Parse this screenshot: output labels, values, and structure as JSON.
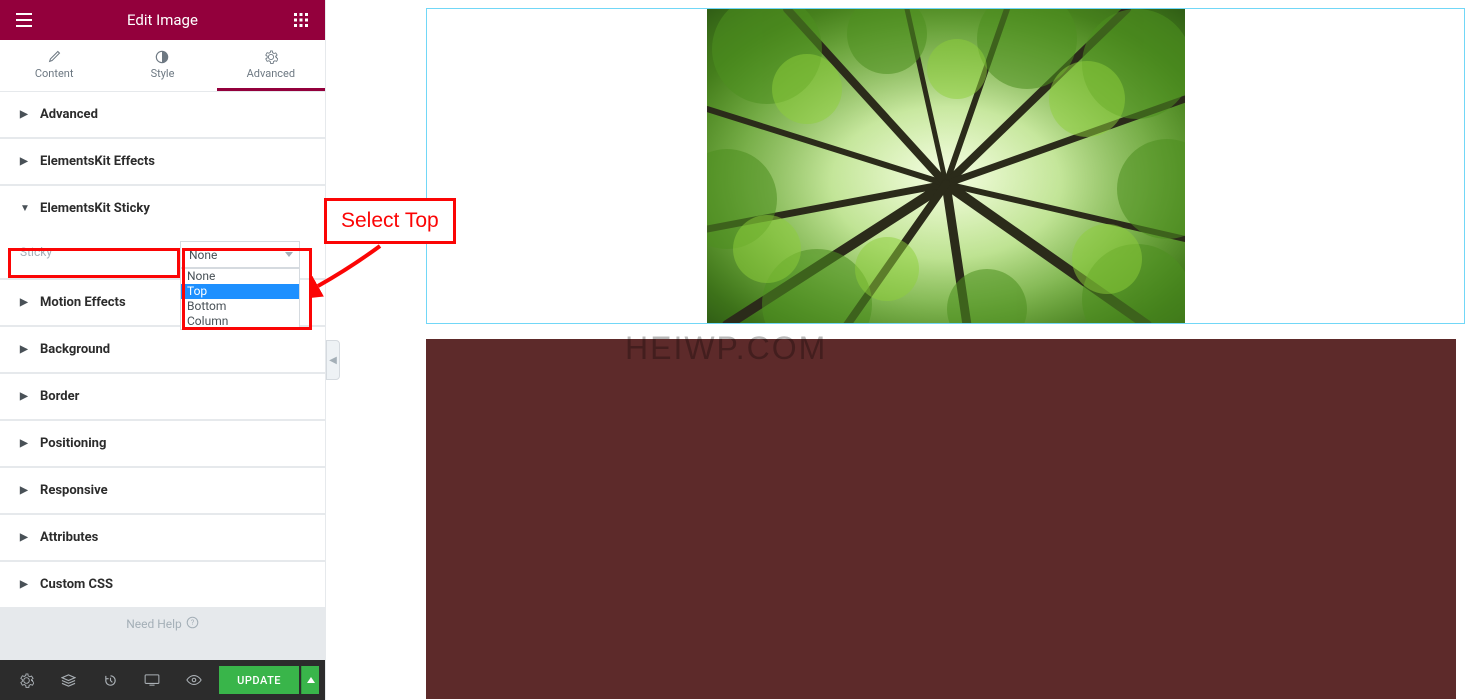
{
  "header": {
    "title": "Edit Image"
  },
  "tabs": {
    "content": "Content",
    "style": "Style",
    "advanced": "Advanced"
  },
  "sections": {
    "advanced": "Advanced",
    "effects": "ElementsKit Effects",
    "sticky": "ElementsKit Sticky",
    "motion": "Motion Effects",
    "background": "Background",
    "border": "Border",
    "positioning": "Positioning",
    "responsive": "Responsive",
    "attributes": "Attributes",
    "customcss": "Custom CSS"
  },
  "sticky": {
    "label": "Sticky",
    "selected": "None",
    "options": [
      "None",
      "Top",
      "Bottom",
      "Column"
    ]
  },
  "needhelp": "Need Help",
  "bottomBar": {
    "update": "UPDATE"
  },
  "annotation": {
    "callout": "Select Top"
  },
  "watermark": "HEIWP.COM"
}
